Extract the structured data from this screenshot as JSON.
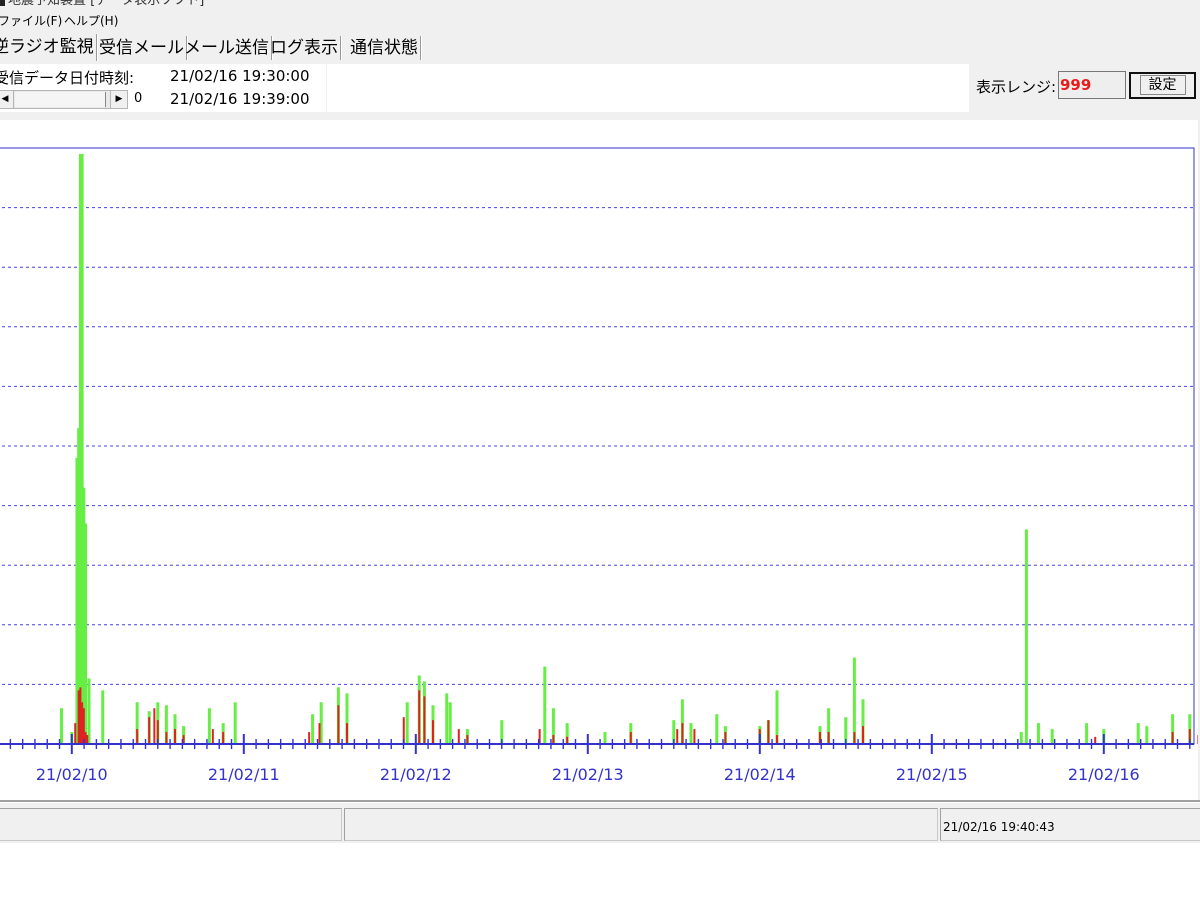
{
  "window": {
    "title": "地震予知装置 [データ表示ソフト]"
  },
  "menu": {
    "file": "ファイル(F)",
    "help": "ヘルプ(H)"
  },
  "tabs": [
    {
      "label": "逆ラジオ監視",
      "active": true
    },
    {
      "label": "受信メール",
      "active": false
    },
    {
      "label": "メール送信",
      "active": false
    },
    {
      "label": "ログ表示",
      "active": false
    },
    {
      "label": "通信状態",
      "active": false
    }
  ],
  "info": {
    "received_label": "受信データ日付時刻:",
    "time_primary": "21/02/16 19:30:00",
    "time_secondary": "21/02/16 19:39:00",
    "scroll_value": "0"
  },
  "range": {
    "label": "表示レンジ:",
    "value": "999",
    "set_button": "設定"
  },
  "status": {
    "timestamp": "21/02/16 19:40:43"
  },
  "colors": {
    "axis": "#3333cc",
    "grid": "#4444dd",
    "green_series": "#66ee44",
    "red_series": "#dd2222",
    "range_value": "#e81c1c"
  },
  "chart_data": {
    "type": "bar",
    "title": "",
    "xlabel": "",
    "ylabel": "",
    "x_tick_labels": [
      "21/02/10",
      "21/02/11",
      "21/02/12",
      "21/02/13",
      "21/02/14",
      "21/02/15",
      "21/02/16"
    ],
    "x_range_days": [
      -0.55,
      6.85
    ],
    "ylim": [
      0,
      1000
    ],
    "grid": "horizontal-dashed",
    "grid_lines": 9,
    "minor_ticks_per_day": 14,
    "series": [
      {
        "x": [
          -0.45,
          -0.06,
          0.0,
          0.03,
          0.04,
          0.05,
          0.06,
          0.07,
          0.08,
          0.1,
          0.18,
          0.38,
          0.45,
          0.5,
          0.55,
          0.6,
          0.65,
          0.8,
          0.88,
          0.95,
          1.4,
          1.45,
          1.55,
          1.6,
          1.95,
          2.02,
          2.05,
          2.1,
          2.18,
          2.2,
          2.3,
          2.5,
          2.75,
          2.8,
          2.88,
          3.1,
          3.25,
          3.5,
          3.55,
          3.6,
          3.75,
          3.8,
          4.0,
          4.05,
          4.1,
          4.35,
          4.4,
          4.5,
          4.55,
          4.6,
          5.52,
          5.55,
          5.62,
          5.7,
          5.9,
          6.0,
          6.2,
          6.25,
          6.4,
          6.5,
          6.6,
          6.7,
          6.73
        ],
        "values": [
          30,
          60,
          20,
          480,
          530,
          990,
          990,
          430,
          370,
          110,
          90,
          70,
          55,
          70,
          65,
          50,
          30,
          60,
          35,
          70,
          50,
          70,
          95,
          85,
          70,
          115,
          105,
          65,
          85,
          70,
          25,
          40,
          130,
          60,
          35,
          20,
          35,
          40,
          75,
          35,
          50,
          30,
          30,
          40,
          90,
          30,
          60,
          45,
          145,
          75,
          20,
          360,
          35,
          25,
          35,
          25,
          35,
          30,
          50,
          50,
          25,
          20,
          25
        ]
      },
      {
        "x": [
          -0.45,
          0.02,
          0.04,
          0.05,
          0.06,
          0.07,
          0.08,
          0.09,
          0.38,
          0.45,
          0.48,
          0.5,
          0.55,
          0.6,
          0.65,
          0.82,
          0.88,
          1.38,
          1.44,
          1.55,
          1.6,
          1.93,
          2.02,
          2.05,
          2.1,
          2.25,
          2.3,
          2.72,
          2.8,
          2.88,
          3.25,
          3.52,
          3.55,
          3.62,
          3.8,
          4.0,
          4.05,
          4.1,
          4.35,
          4.4,
          4.55,
          4.6,
          5.95,
          6.4,
          6.5,
          6.55
        ],
        "values": [
          15,
          35,
          90,
          95,
          70,
          60,
          20,
          15,
          25,
          45,
          60,
          40,
          20,
          25,
          15,
          25,
          20,
          20,
          35,
          65,
          35,
          45,
          90,
          80,
          40,
          25,
          15,
          25,
          15,
          12,
          20,
          25,
          35,
          25,
          20,
          25,
          40,
          15,
          20,
          20,
          20,
          30,
          12,
          20,
          25,
          15
        ]
      }
    ]
  }
}
